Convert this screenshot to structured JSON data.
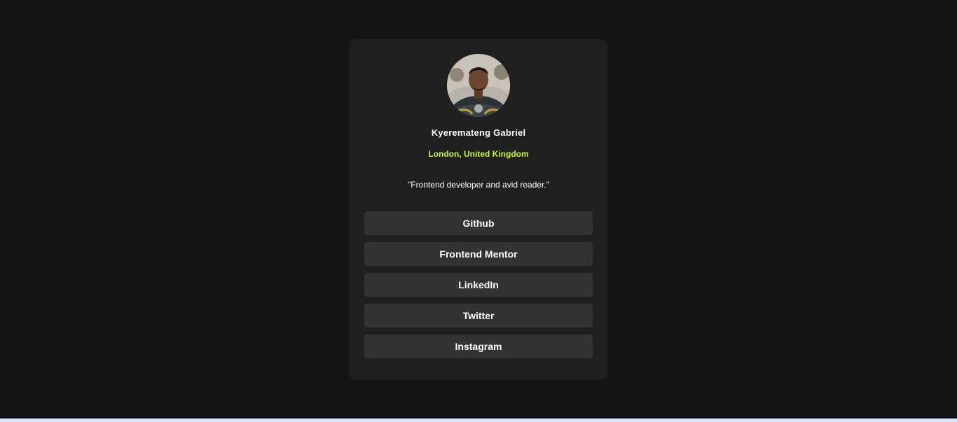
{
  "profile": {
    "name": "Kyeremateng Gabriel",
    "location": "London, United Kingdom",
    "bio": "\"Frontend developer and avid reader.\""
  },
  "links": [
    {
      "label": "Github"
    },
    {
      "label": "Frontend Mentor"
    },
    {
      "label": "LinkedIn"
    },
    {
      "label": "Twitter"
    },
    {
      "label": "Instagram"
    }
  ],
  "colors": {
    "page_background": "#141414",
    "card_background": "#1f1f1f",
    "button_background": "#333333",
    "accent": "#c4f82a",
    "text": "#ffffff"
  }
}
